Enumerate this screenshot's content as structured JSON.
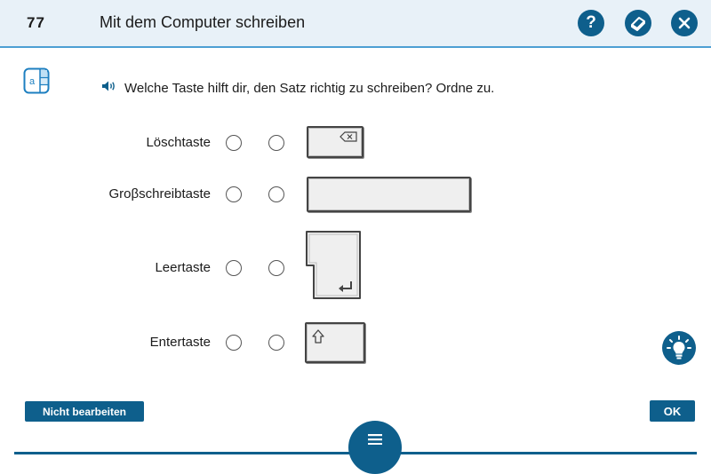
{
  "header": {
    "page_number": "77",
    "title": "Mit dem Computer schreiben",
    "help_icon": "question-icon",
    "book_icon": "book-icon",
    "close_icon": "close-icon"
  },
  "task": {
    "type_icon": "task-type-icon",
    "type_icon_text": "a",
    "audio_icon": "speaker-icon",
    "question": "Welche Taste hilft dir, den Satz richtig zu schreiben? Ordne zu."
  },
  "labels": [
    "Löschtaste",
    "Groβschreibtaste",
    "Leertaste",
    "Entertaste"
  ],
  "keys": [
    "backspace-key",
    "space-key",
    "enter-key",
    "shift-key"
  ],
  "hint_icon": "lightbulb-icon",
  "footer": {
    "skip_label": "Nicht bearbeiten",
    "ok_label": "OK",
    "menu_icon": "menu-icon"
  },
  "colors": {
    "accent": "#0e5f8c",
    "header_bg": "#e8f1f8",
    "header_border": "#4d9fd3"
  }
}
